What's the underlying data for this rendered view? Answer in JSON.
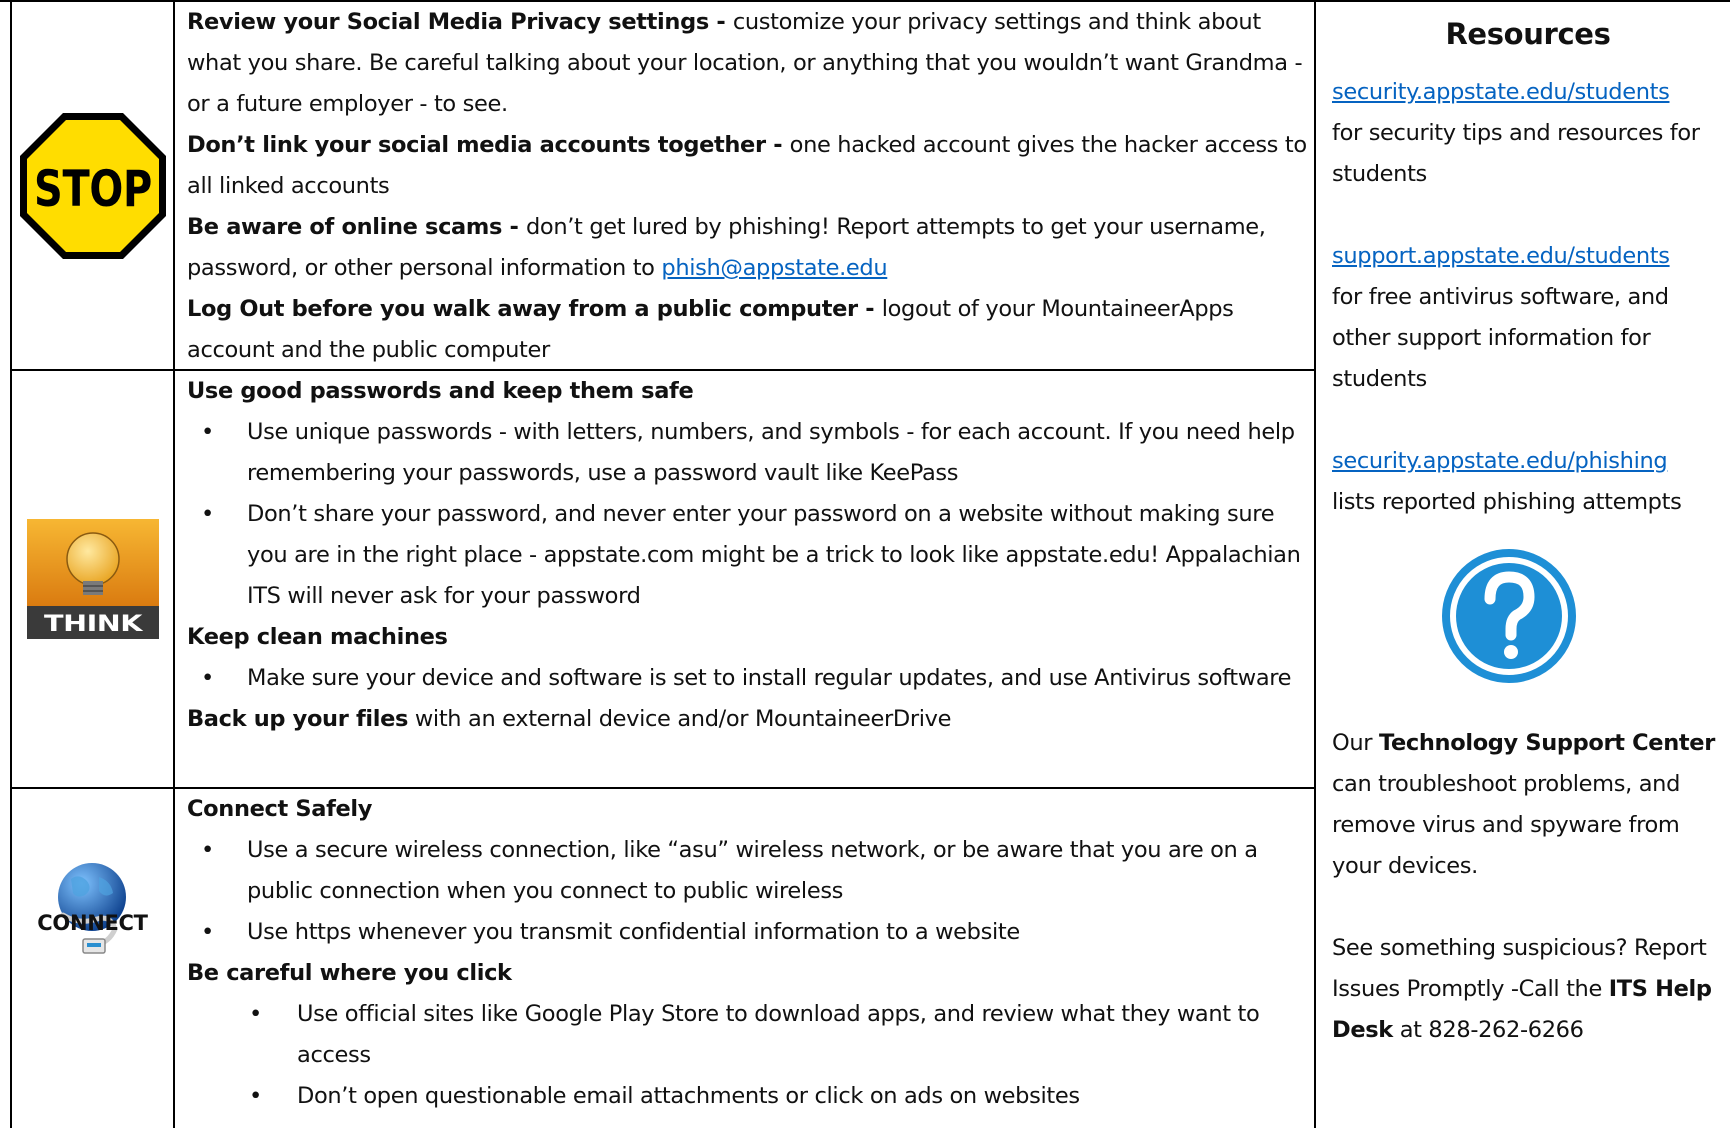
{
  "stop": {
    "icon": "stop-sign-icon",
    "icon_text": "STOP",
    "colors": {
      "sign_fill": "#ffdd00",
      "sign_border": "#000000"
    },
    "items": [
      {
        "bold": "Review your Social Media Privacy settings - ",
        "text": "customize your privacy settings and think about what you share.  Be careful talking about your location, or anything that you wouldn’t want Grandma - or a future employer - to see."
      },
      {
        "bold": "Don’t link your social media accounts together - ",
        "text": "one hacked account gives the hacker access to all linked accounts"
      },
      {
        "bold": "Be aware of online scams - ",
        "text": "don’t get lured by phishing!  Report attempts to get your username, password, or other personal information to ",
        "link": "phish@appstate.edu"
      },
      {
        "bold": "Log Out before you walk away from a public computer - ",
        "text": "logout of your MountaineerApps account and the public computer"
      }
    ]
  },
  "think": {
    "icon": "lightbulb-icon",
    "label": "THINK",
    "heading1": "Use good passwords and keep them safe",
    "bullets1": [
      "Use unique passwords - with letters, numbers, and symbols - for each account.  If you need help remembering your passwords, use a password vault like KeePass",
      "Don’t share your password, and never enter your password on a website without making sure you are in the right place - appstate.com might be a trick to look like appstate.edu!  Appalachian ITS will never ask for your password"
    ],
    "heading2": "Keep clean machines",
    "bullets2": [
      "Make sure your device and software is set to install regular updates, and use Antivirus software"
    ],
    "backup_bold": "Back up your files",
    "backup_text": " with an external device and/or MountaineerDrive"
  },
  "connect": {
    "icon": "globe-network-icon",
    "label": "CONNECT",
    "heading1": "Connect Safely",
    "bullets1": [
      "Use a secure wireless connection, like “asu” wireless network, or be aware that you are on a public connection when you connect to public wireless",
      "Use https whenever you transmit confidential information to a website"
    ],
    "heading2": "Be careful where you click",
    "bullets2": [
      "Use official sites like Google Play Store to download apps, and review what they want to access",
      "Don’t open questionable email attachments or click on ads on websites"
    ]
  },
  "resources": {
    "title": "Resources",
    "links": [
      {
        "url": "security.appstate.edu/students",
        "desc": "for security tips and resources for students"
      },
      {
        "url": "support.appstate.edu/students",
        "desc": "for free antivirus software, and other support information for students"
      },
      {
        "url": "security.appstate.edu/phishing",
        "desc": "lists reported phishing attempts"
      }
    ],
    "help_icon": "question-mark-icon",
    "tsc_pre": "Our ",
    "tsc_bold": "Technology Support Center",
    "tsc_post": " can troubleshoot problems, and remove virus and spyware from your devices.",
    "report_text": "See something suspicious? Report Issues Promptly -Call the ",
    "helpdesk_bold": "ITS Help Desk",
    "helpdesk_post": " at 828-262-6266",
    "colors": {
      "link": "#0563c1",
      "help_icon": "#1e8fd6"
    }
  }
}
